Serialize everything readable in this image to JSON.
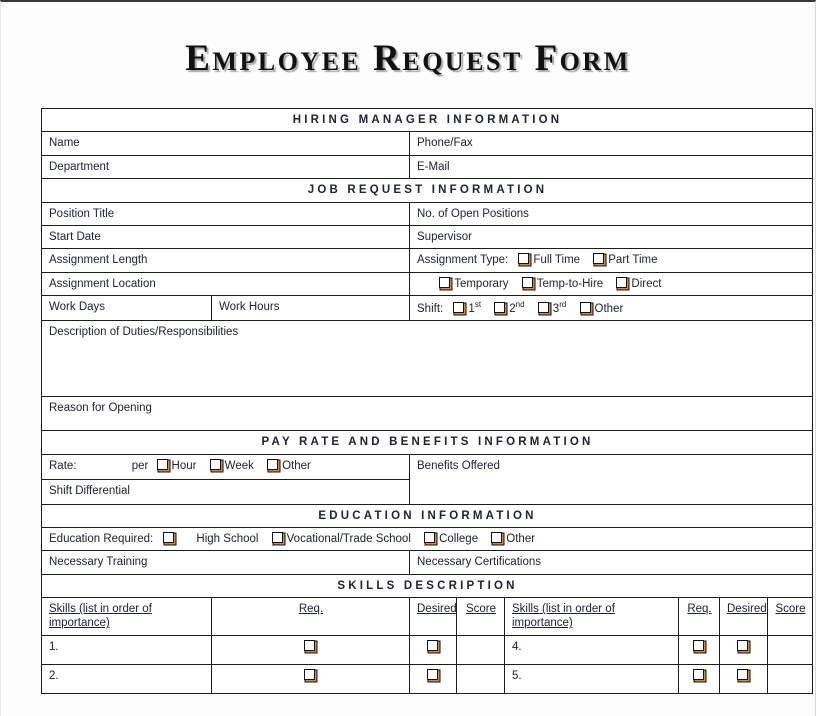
{
  "document": {
    "title": "Employee Request Form"
  },
  "sections": {
    "hiring_manager": {
      "band": "Hiring Manager Information",
      "name_label": "Name",
      "phone_fax_label": "Phone/Fax",
      "department_label": "Department",
      "email_label": "E-Mail"
    },
    "job_request": {
      "band": "Job Request Information",
      "position_title_label": "Position Title",
      "open_positions_label": "No. of Open Positions",
      "start_date_label": "Start Date",
      "supervisor_label": "Supervisor",
      "assignment_length_label": "Assignment Length",
      "assignment_type_label": "Assignment Type:",
      "assignment_types_row1": [
        "Full Time",
        "Part Time"
      ],
      "assignment_types_row2": [
        "Temporary",
        "Temp-to-Hire",
        "Direct"
      ],
      "assignment_location_label": "Assignment Location",
      "work_days_label": "Work Days",
      "work_hours_label": "Work Hours",
      "shift_label": "Shift:",
      "shift_options": [
        {
          "num": "1",
          "ord": "st"
        },
        {
          "num": "2",
          "ord": "nd"
        },
        {
          "num": "3",
          "ord": "rd"
        }
      ],
      "shift_other": "Other",
      "duties_label": "Description of Duties/Responsibilities",
      "reason_label": "Reason for Opening"
    },
    "pay_rate": {
      "band": "Pay Rate and Benefits Information",
      "rate_label": "Rate:",
      "per_label": "per",
      "rate_options": [
        "Hour",
        "Week",
        "Other"
      ],
      "benefits_label": "Benefits Offered",
      "shift_differential_label": "Shift Differential"
    },
    "education": {
      "band": "Education Information",
      "education_required_label": "Education Required:",
      "education_options": [
        "High School",
        "Vocational/Trade School",
        "College",
        "Other"
      ],
      "necessary_training_label": "Necessary Training",
      "necessary_certifications_label": "Necessary Certifications"
    },
    "skills": {
      "band": "Skills Description",
      "col_skills": "Skills (list in order of importance)",
      "col_req": "Req.",
      "col_desired": "Desired",
      "col_score": "Score",
      "rows": [
        {
          "left": "1.",
          "right": "4."
        },
        {
          "left": "2.",
          "right": "5."
        }
      ]
    }
  }
}
